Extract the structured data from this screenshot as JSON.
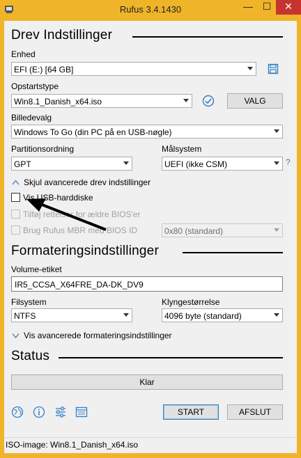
{
  "window": {
    "title": "Rufus 3.4.1430",
    "minimize": "—",
    "maximize": "☐",
    "close": "✕"
  },
  "drive": {
    "section_title": "Drev Indstillinger",
    "device_label": "Enhed",
    "device_value": "EFI (E:) [64 GB]",
    "boot_label": "Opstartstype",
    "boot_value": "Win8.1_Danish_x64.iso",
    "select_button": "VALG",
    "image_option_label": "Billedevalg",
    "image_option_value": "Windows To Go (din PC på en USB-nøgle)",
    "partition_label": "Partitionsordning",
    "partition_value": "GPT",
    "target_label": "Målsystem",
    "target_value": "UEFI (ikke CSM)",
    "help": "?",
    "advanced_toggle": "Skjul avancerede drev indstillinger",
    "list_usb_label": "Vis USB-harddiske",
    "old_bios_label": "Tilføj rettelser for ældre BIOS'er",
    "mbr_label": "Brug Rufus MBR med BIOS ID",
    "bios_id_value": "0x80 (standard)"
  },
  "format": {
    "section_title": "Formateringsindstillinger",
    "volume_label": "Volume-etiket",
    "volume_value": "IR5_CCSA_X64FRE_DA-DK_DV9",
    "fs_label": "Filsystem",
    "fs_value": "NTFS",
    "cluster_label": "Klyngestørrelse",
    "cluster_value": "4096 byte (standard)",
    "advanced_toggle": "Vis avancerede formateringsindstillinger"
  },
  "status": {
    "section_title": "Status",
    "progress_text": "Klar",
    "start_button": "START",
    "close_button": "AFSLUT",
    "statusbar_text": "ISO-image: Win8.1_Danish_x64.iso"
  },
  "colors": {
    "frame": "#f0b429",
    "close_button": "#c7342f",
    "accent": "#2f7fc4"
  }
}
